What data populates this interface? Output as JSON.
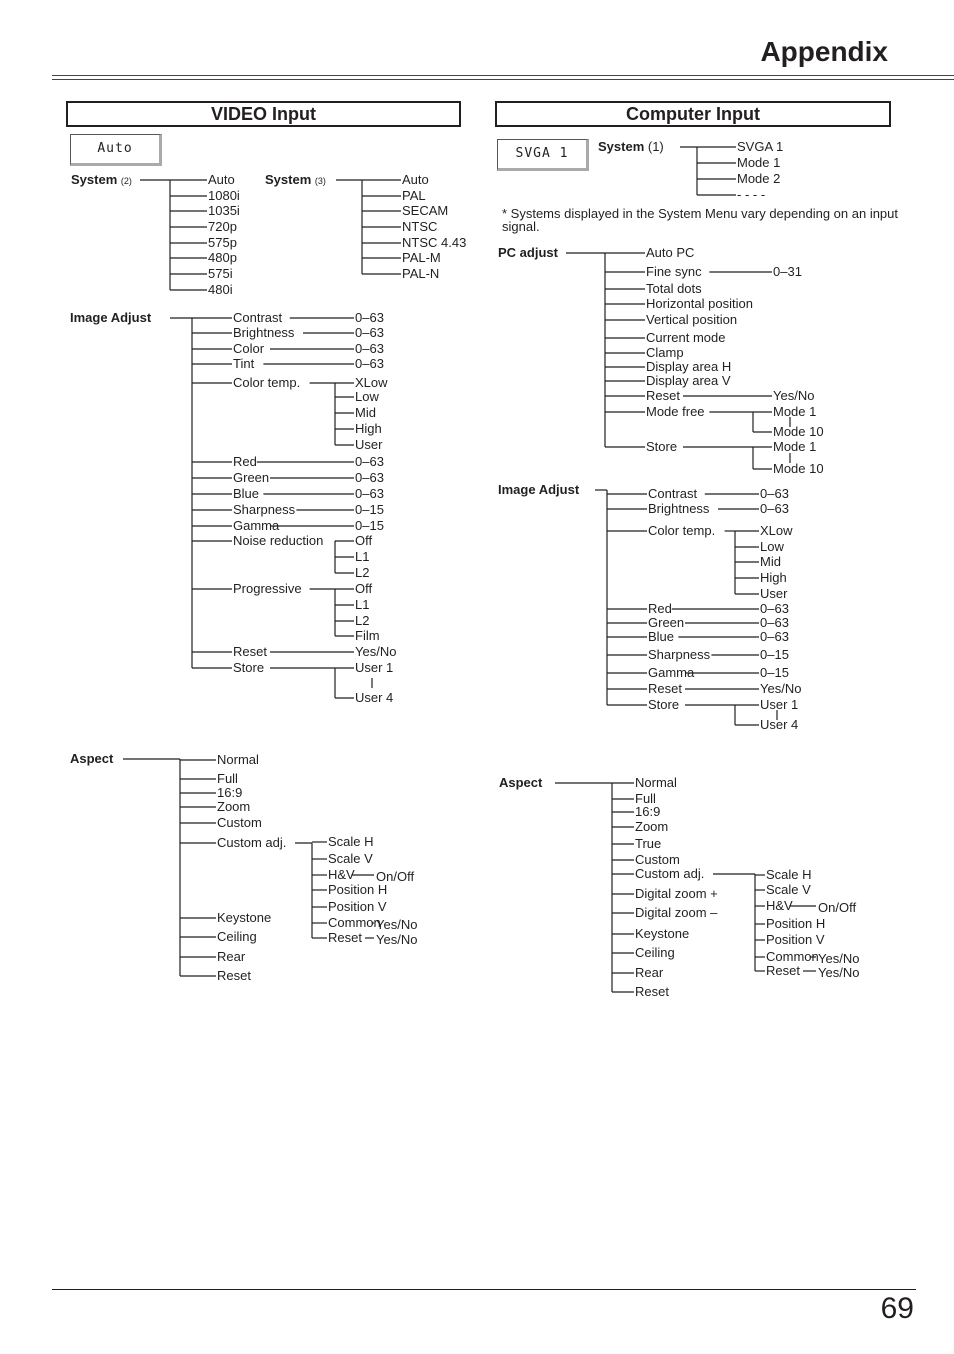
{
  "page": {
    "title": "Appendix",
    "page_number": "69"
  },
  "video": {
    "section_title": "VIDEO Input",
    "osd_display": "Auto",
    "system2": {
      "label": "System",
      "note": "(2)",
      "items": [
        "Auto",
        "1080i",
        "1035i",
        "720p",
        "575p",
        "480p",
        "575i",
        "480i"
      ]
    },
    "system3": {
      "label": "System",
      "note": "(3)",
      "items": [
        "Auto",
        "PAL",
        "SECAM",
        "NTSC",
        "NTSC 4.43",
        "PAL-M",
        "PAL-N"
      ]
    },
    "image_adjust": {
      "label": "Image Adjust",
      "items": [
        {
          "name": "Contrast",
          "value": "0–63"
        },
        {
          "name": "Brightness",
          "value": "0–63"
        },
        {
          "name": "Color",
          "value": "0–63"
        },
        {
          "name": "Tint",
          "value": "0–63"
        },
        {
          "name": "Color temp.",
          "options": [
            "XLow",
            "Low",
            "Mid",
            "High",
            "User"
          ]
        },
        {
          "name": "Red",
          "value": "0–63"
        },
        {
          "name": "Green",
          "value": "0–63"
        },
        {
          "name": "Blue",
          "value": "0–63"
        },
        {
          "name": "Sharpness",
          "value": "0–15"
        },
        {
          "name": "Gamma",
          "value": "0–15"
        },
        {
          "name": "Noise reduction",
          "options": [
            "Off",
            "L1",
            "L2"
          ]
        },
        {
          "name": "Progressive",
          "options": [
            "Off",
            "L1",
            "L2",
            "Film"
          ]
        },
        {
          "name": "Reset",
          "value": "Yes/No"
        },
        {
          "name": "Store",
          "options": [
            "User 1",
            "User 4"
          ]
        }
      ]
    },
    "aspect": {
      "label": "Aspect",
      "items": [
        "Normal",
        "Full",
        "16:9",
        "Zoom",
        "Custom",
        "Custom adj.",
        "Keystone",
        "Ceiling",
        "Rear",
        "Reset"
      ],
      "custom_adj": [
        "Scale H",
        "Scale V",
        "H&V",
        "Position H",
        "Position V",
        "Common",
        "Reset"
      ],
      "custom_adj_values": {
        "H&V": "On/Off",
        "Common": "Yes/No",
        "Reset": "Yes/No"
      }
    }
  },
  "computer": {
    "section_title": "Computer Input",
    "osd_display": "SVGA 1",
    "system1": {
      "label": "System",
      "note": "(1)",
      "items": [
        "SVGA 1",
        "Mode 1",
        "Mode 2",
        "- - - -"
      ]
    },
    "footnote": "* Systems displayed in the System Menu vary depending on an input signal.",
    "pc_adjust": {
      "label": "PC adjust",
      "items": [
        {
          "name": "Auto PC"
        },
        {
          "name": "Fine sync",
          "value": "0–31"
        },
        {
          "name": "Total dots"
        },
        {
          "name": "Horizontal position"
        },
        {
          "name": "Vertical position"
        },
        {
          "name": "Current mode"
        },
        {
          "name": "Clamp"
        },
        {
          "name": "Display area H"
        },
        {
          "name": "Display area V"
        },
        {
          "name": "Reset",
          "value": "Yes/No"
        },
        {
          "name": "Mode free",
          "options": [
            "Mode 1",
            "Mode 10"
          ]
        },
        {
          "name": "Store",
          "options": [
            "Mode 1",
            "Mode 10"
          ]
        }
      ]
    },
    "image_adjust": {
      "label": "Image Adjust",
      "items": [
        {
          "name": "Contrast",
          "value": "0–63"
        },
        {
          "name": "Brightness",
          "value": "0–63"
        },
        {
          "name": "Color temp.",
          "options": [
            "XLow",
            "Low",
            "Mid",
            "High",
            "User"
          ]
        },
        {
          "name": "Red",
          "value": "0–63"
        },
        {
          "name": "Green",
          "value": "0–63"
        },
        {
          "name": "Blue",
          "value": "0–63"
        },
        {
          "name": "Sharpness",
          "value": "0–15"
        },
        {
          "name": "Gamma",
          "value": "0–15"
        },
        {
          "name": "Reset",
          "value": "Yes/No"
        },
        {
          "name": "Store",
          "options": [
            "User 1",
            "User 4"
          ]
        }
      ]
    },
    "aspect": {
      "label": "Aspect",
      "items": [
        "Normal",
        "Full",
        "16:9",
        "Zoom",
        "True",
        "Custom",
        "Custom adj.",
        "Digital zoom +",
        "Digital zoom –",
        "Keystone",
        "Ceiling",
        "Rear",
        "Reset"
      ],
      "custom_adj": [
        "Scale H",
        "Scale V",
        "H&V",
        "Position H",
        "Position V",
        "Common",
        "Reset"
      ],
      "custom_adj_values": {
        "H&V": "On/Off",
        "Common": "Yes/No",
        "Reset": "Yes/No"
      }
    }
  }
}
